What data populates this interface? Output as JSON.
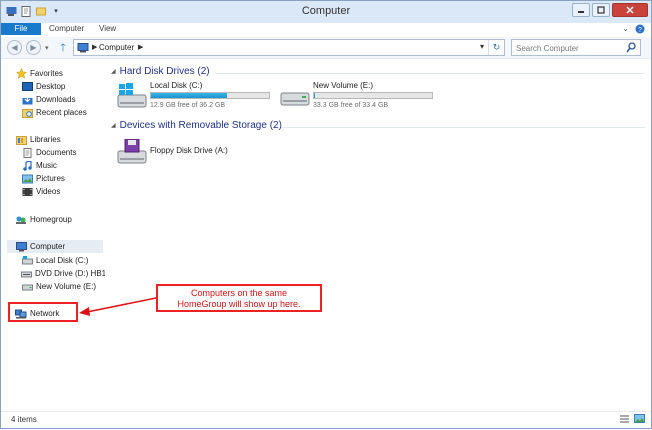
{
  "window": {
    "title": "Computer"
  },
  "ribbon": {
    "tabs": [
      "File",
      "Computer",
      "View"
    ]
  },
  "address": {
    "crumb": "Computer"
  },
  "search": {
    "placeholder": "Search Computer"
  },
  "nav": {
    "favorites": {
      "label": "Favorites",
      "items": [
        "Desktop",
        "Downloads",
        "Recent places"
      ]
    },
    "libraries": {
      "label": "Libraries",
      "items": [
        "Documents",
        "Music",
        "Pictures",
        "Videos"
      ]
    },
    "homegroup": {
      "label": "Homegroup"
    },
    "computer": {
      "label": "Computer",
      "items": [
        "Local Disk (C:)",
        "DVD Drive (D:) HB1_",
        "New Volume (E:)"
      ]
    },
    "network": {
      "label": "Network"
    }
  },
  "groups": {
    "hdd": {
      "header": "Hard Disk Drives (2)",
      "drives": [
        {
          "name": "Local Disk (C:)",
          "free": "12.9 GB free of 36.2 GB",
          "used_fraction": 0.64
        },
        {
          "name": "New Volume (E:)",
          "free": "33.3 GB free of 33.4 GB",
          "used_fraction": 0.003
        }
      ]
    },
    "removable": {
      "header": "Devices with Removable Storage (2)",
      "drives": [
        {
          "name": "Floppy Disk Drive (A:)"
        }
      ]
    }
  },
  "callout": {
    "line1": "Computers on the same",
    "line2": "HomeGroup will show up here."
  },
  "status": {
    "items": "4 items"
  },
  "colors": {
    "accent": "#1979ca",
    "callout": "#dd1111",
    "bar_fill": "#26a0da"
  }
}
